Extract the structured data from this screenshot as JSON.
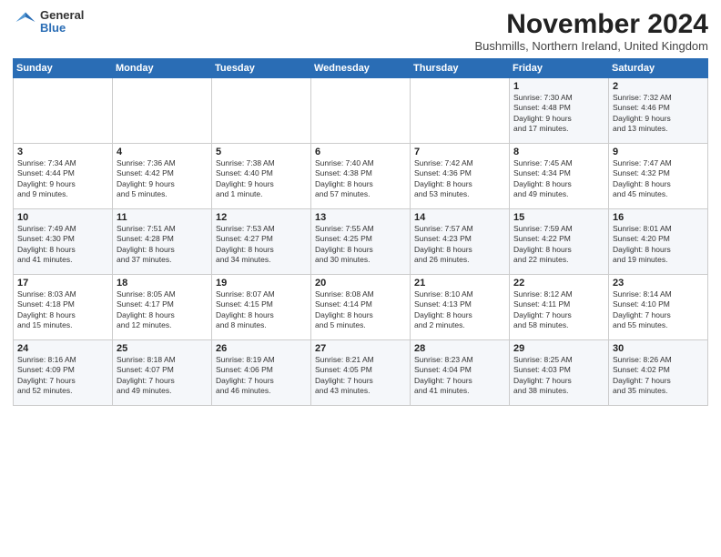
{
  "header": {
    "logo_general": "General",
    "logo_blue": "Blue",
    "month_title": "November 2024",
    "subtitle": "Bushmills, Northern Ireland, United Kingdom"
  },
  "weekdays": [
    "Sunday",
    "Monday",
    "Tuesday",
    "Wednesday",
    "Thursday",
    "Friday",
    "Saturday"
  ],
  "weeks": [
    [
      {
        "day": "",
        "info": ""
      },
      {
        "day": "",
        "info": ""
      },
      {
        "day": "",
        "info": ""
      },
      {
        "day": "",
        "info": ""
      },
      {
        "day": "",
        "info": ""
      },
      {
        "day": "1",
        "info": "Sunrise: 7:30 AM\nSunset: 4:48 PM\nDaylight: 9 hours\nand 17 minutes."
      },
      {
        "day": "2",
        "info": "Sunrise: 7:32 AM\nSunset: 4:46 PM\nDaylight: 9 hours\nand 13 minutes."
      }
    ],
    [
      {
        "day": "3",
        "info": "Sunrise: 7:34 AM\nSunset: 4:44 PM\nDaylight: 9 hours\nand 9 minutes."
      },
      {
        "day": "4",
        "info": "Sunrise: 7:36 AM\nSunset: 4:42 PM\nDaylight: 9 hours\nand 5 minutes."
      },
      {
        "day": "5",
        "info": "Sunrise: 7:38 AM\nSunset: 4:40 PM\nDaylight: 9 hours\nand 1 minute."
      },
      {
        "day": "6",
        "info": "Sunrise: 7:40 AM\nSunset: 4:38 PM\nDaylight: 8 hours\nand 57 minutes."
      },
      {
        "day": "7",
        "info": "Sunrise: 7:42 AM\nSunset: 4:36 PM\nDaylight: 8 hours\nand 53 minutes."
      },
      {
        "day": "8",
        "info": "Sunrise: 7:45 AM\nSunset: 4:34 PM\nDaylight: 8 hours\nand 49 minutes."
      },
      {
        "day": "9",
        "info": "Sunrise: 7:47 AM\nSunset: 4:32 PM\nDaylight: 8 hours\nand 45 minutes."
      }
    ],
    [
      {
        "day": "10",
        "info": "Sunrise: 7:49 AM\nSunset: 4:30 PM\nDaylight: 8 hours\nand 41 minutes."
      },
      {
        "day": "11",
        "info": "Sunrise: 7:51 AM\nSunset: 4:28 PM\nDaylight: 8 hours\nand 37 minutes."
      },
      {
        "day": "12",
        "info": "Sunrise: 7:53 AM\nSunset: 4:27 PM\nDaylight: 8 hours\nand 34 minutes."
      },
      {
        "day": "13",
        "info": "Sunrise: 7:55 AM\nSunset: 4:25 PM\nDaylight: 8 hours\nand 30 minutes."
      },
      {
        "day": "14",
        "info": "Sunrise: 7:57 AM\nSunset: 4:23 PM\nDaylight: 8 hours\nand 26 minutes."
      },
      {
        "day": "15",
        "info": "Sunrise: 7:59 AM\nSunset: 4:22 PM\nDaylight: 8 hours\nand 22 minutes."
      },
      {
        "day": "16",
        "info": "Sunrise: 8:01 AM\nSunset: 4:20 PM\nDaylight: 8 hours\nand 19 minutes."
      }
    ],
    [
      {
        "day": "17",
        "info": "Sunrise: 8:03 AM\nSunset: 4:18 PM\nDaylight: 8 hours\nand 15 minutes."
      },
      {
        "day": "18",
        "info": "Sunrise: 8:05 AM\nSunset: 4:17 PM\nDaylight: 8 hours\nand 12 minutes."
      },
      {
        "day": "19",
        "info": "Sunrise: 8:07 AM\nSunset: 4:15 PM\nDaylight: 8 hours\nand 8 minutes."
      },
      {
        "day": "20",
        "info": "Sunrise: 8:08 AM\nSunset: 4:14 PM\nDaylight: 8 hours\nand 5 minutes."
      },
      {
        "day": "21",
        "info": "Sunrise: 8:10 AM\nSunset: 4:13 PM\nDaylight: 8 hours\nand 2 minutes."
      },
      {
        "day": "22",
        "info": "Sunrise: 8:12 AM\nSunset: 4:11 PM\nDaylight: 7 hours\nand 58 minutes."
      },
      {
        "day": "23",
        "info": "Sunrise: 8:14 AM\nSunset: 4:10 PM\nDaylight: 7 hours\nand 55 minutes."
      }
    ],
    [
      {
        "day": "24",
        "info": "Sunrise: 8:16 AM\nSunset: 4:09 PM\nDaylight: 7 hours\nand 52 minutes."
      },
      {
        "day": "25",
        "info": "Sunrise: 8:18 AM\nSunset: 4:07 PM\nDaylight: 7 hours\nand 49 minutes."
      },
      {
        "day": "26",
        "info": "Sunrise: 8:19 AM\nSunset: 4:06 PM\nDaylight: 7 hours\nand 46 minutes."
      },
      {
        "day": "27",
        "info": "Sunrise: 8:21 AM\nSunset: 4:05 PM\nDaylight: 7 hours\nand 43 minutes."
      },
      {
        "day": "28",
        "info": "Sunrise: 8:23 AM\nSunset: 4:04 PM\nDaylight: 7 hours\nand 41 minutes."
      },
      {
        "day": "29",
        "info": "Sunrise: 8:25 AM\nSunset: 4:03 PM\nDaylight: 7 hours\nand 38 minutes."
      },
      {
        "day": "30",
        "info": "Sunrise: 8:26 AM\nSunset: 4:02 PM\nDaylight: 7 hours\nand 35 minutes."
      }
    ]
  ]
}
